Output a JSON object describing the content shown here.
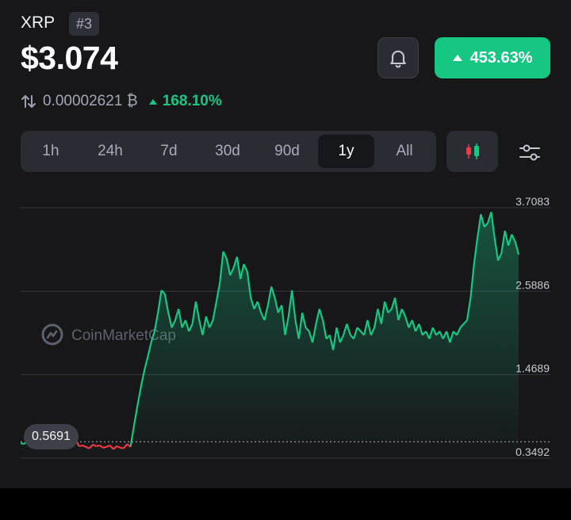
{
  "coin": {
    "name": "XRP",
    "rank": "#3",
    "price": "$3.074"
  },
  "change": {
    "pct": "453.63%",
    "color": "#16c784"
  },
  "btc": {
    "value": "0.00002621 ₿",
    "change": "168.10%"
  },
  "icons": {
    "swap": "swap-vertical-icon",
    "bell": "bell-icon",
    "candle": "candlestick-icon",
    "filter": "sliders-icon",
    "logo": "coinmarketcap-logo-icon"
  },
  "ranges": [
    "1h",
    "24h",
    "7d",
    "30d",
    "90d",
    "1y",
    "All"
  ],
  "active_range": "1y",
  "chart_data": {
    "type": "line",
    "series": [
      {
        "values": [
          0.55,
          0.54,
          0.57,
          0.56,
          0.5,
          0.52,
          0.49,
          0.53,
          0.55,
          0.52,
          0.56,
          0.58,
          0.55,
          0.53,
          0.57,
          0.54,
          0.6,
          0.51,
          0.52,
          0.5,
          0.48,
          0.53,
          0.51,
          0.52,
          0.49,
          0.5,
          0.52,
          0.47,
          0.51,
          0.49,
          0.48,
          0.54,
          0.5,
          0.78,
          1.05,
          1.3,
          1.52,
          1.7,
          1.9,
          2.05,
          2.3,
          2.6,
          2.55,
          2.3,
          2.1,
          2.2,
          2.35,
          2.1,
          2.2,
          2.05,
          2.15,
          2.45,
          2.2,
          2.0,
          2.25,
          2.1,
          2.2,
          2.45,
          2.7,
          3.12,
          3.02,
          2.8,
          2.9,
          3.05,
          2.75,
          2.95,
          2.85,
          2.5,
          2.35,
          2.45,
          2.3,
          2.2,
          2.4,
          2.65,
          2.5,
          2.3,
          2.4,
          2.0,
          2.25,
          2.6,
          2.2,
          1.95,
          2.3,
          2.1,
          2.05,
          1.9,
          2.15,
          2.35,
          2.2,
          1.95,
          2.0,
          1.8,
          2.1,
          1.9,
          2.0,
          2.15,
          2.0,
          1.95,
          2.1,
          2.05,
          2.0,
          2.2,
          2.0,
          2.1,
          2.35,
          2.15,
          2.45,
          2.3,
          2.35,
          2.5,
          2.2,
          2.35,
          2.25,
          2.1,
          2.2,
          2.05,
          2.15,
          2.0,
          2.05,
          1.95,
          2.1,
          2.0,
          2.05,
          1.95,
          2.05,
          1.9,
          2.05,
          2.0,
          2.1,
          2.15,
          2.2,
          2.5,
          2.95,
          3.3,
          3.62,
          3.45,
          3.5,
          3.65,
          3.3,
          3.0,
          3.1,
          3.4,
          3.2,
          3.35,
          3.25,
          3.08
        ],
        "base": 0.5691,
        "colors": {
          "above": "#16c784",
          "below": "#ea3943"
        }
      }
    ],
    "ylim": [
      0.3492,
      3.7083
    ],
    "yticks": [
      "3.7083",
      "2.5886",
      "1.4689",
      "0.3492"
    ],
    "current_label": "0.5691",
    "grid": true,
    "watermark": "CoinMarketCap"
  }
}
